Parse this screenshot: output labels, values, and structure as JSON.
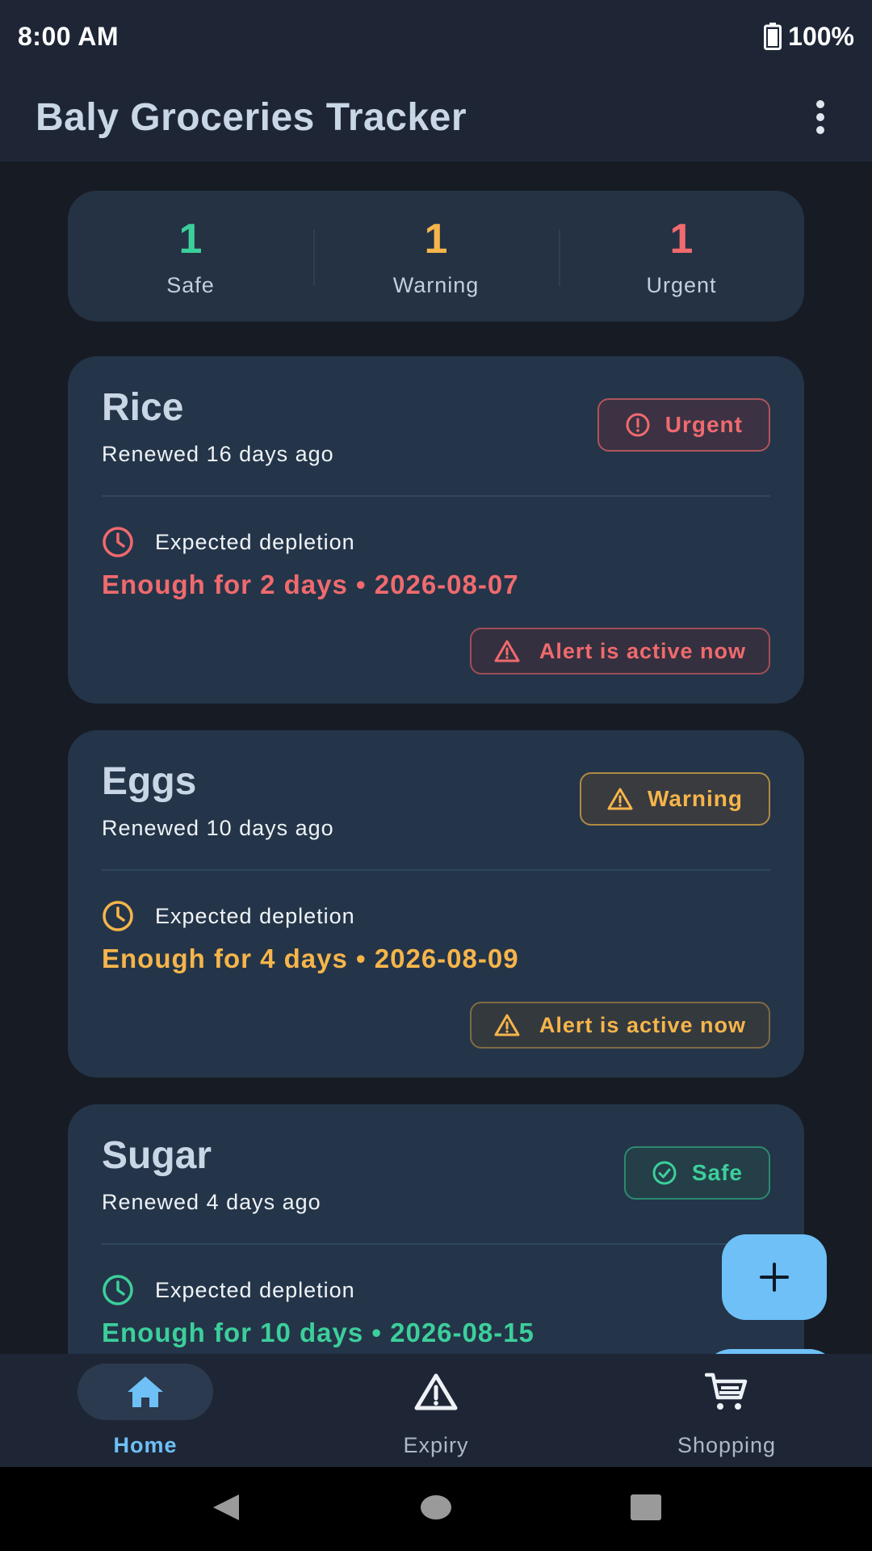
{
  "status_bar": {
    "time": "8:00 AM",
    "battery": "100%"
  },
  "app_bar": {
    "title": "Baly Groceries Tracker",
    "menu_icon": "more-vert-icon"
  },
  "summary": [
    {
      "count": "1",
      "label": "Safe",
      "color": "#3ccf9b"
    },
    {
      "count": "1",
      "label": "Warning",
      "color": "#f6b54a"
    },
    {
      "count": "1",
      "label": "Urgent",
      "color": "#f06a6e"
    }
  ],
  "items": [
    {
      "name": "Rice",
      "renewed": "Renewed 16 days ago",
      "badge": "Urgent",
      "badge_icon": "alert-circle-icon",
      "depletion_label": "Expected depletion",
      "depletion_value": "Enough for 2 days • 2026-08-07",
      "alert": "Alert is active now",
      "color": "#f06a6e"
    },
    {
      "name": "Eggs",
      "renewed": "Renewed 10 days ago",
      "badge": "Warning",
      "badge_icon": "warning-triangle-icon",
      "depletion_label": "Expected depletion",
      "depletion_value": "Enough for 4 days • 2026-08-09",
      "alert": "Alert is active now",
      "color": "#f6b54a"
    },
    {
      "name": "Sugar",
      "renewed": "Renewed 4 days ago",
      "badge": "Safe",
      "badge_icon": "check-circle-icon",
      "depletion_label": "Expected depletion",
      "depletion_value": "Enough for 10 days • 2026-08-15",
      "color": "#3ccf9b"
    }
  ],
  "fabs": {
    "add_icon": "plus-icon",
    "search_icon": "search-icon"
  },
  "bottom_nav": [
    {
      "label": "Home",
      "icon": "home-icon",
      "active": true
    },
    {
      "label": "Expiry",
      "icon": "warning-triangle-icon",
      "active": false
    },
    {
      "label": "Shopping",
      "icon": "cart-icon",
      "active": false
    }
  ],
  "colors": {
    "accent": "#6ec0f6",
    "card": "#243549",
    "background": "#171b24"
  }
}
